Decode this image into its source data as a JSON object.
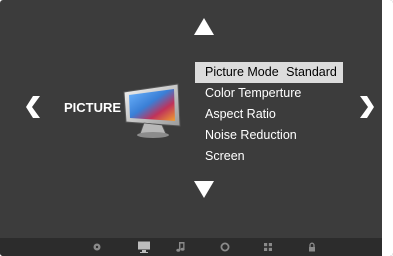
{
  "section": {
    "title": "PICTURE"
  },
  "menu": {
    "items": [
      {
        "label": "Picture Mode",
        "value": "Standard",
        "selected": true
      },
      {
        "label": "Color Temperture",
        "selected": false
      },
      {
        "label": "Aspect Ratio",
        "selected": false
      },
      {
        "label": "Noise Reduction",
        "selected": false
      },
      {
        "label": "Screen",
        "selected": false
      }
    ]
  },
  "bottom_bar": {
    "icons": [
      "settings-dot-icon",
      "monitor-icon",
      "music-note-icon",
      "circle-icon",
      "grid-icon",
      "lock-icon"
    ]
  },
  "colors": {
    "background": "#3c3c3c",
    "highlight": "#dcdcdc",
    "text": "#ffffff"
  }
}
